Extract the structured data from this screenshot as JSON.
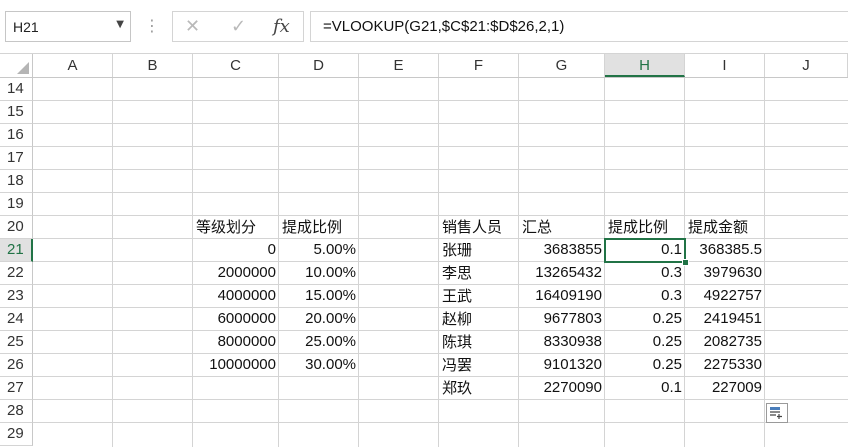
{
  "name_box": {
    "value": "H21"
  },
  "formula_bar": {
    "cancel_icon": "✕",
    "enter_icon": "✓",
    "fx_label": "fx",
    "formula": "=VLOOKUP(G21,$C$21:$D$26,2,1)"
  },
  "columns": [
    "A",
    "B",
    "C",
    "D",
    "E",
    "F",
    "G",
    "H",
    "I",
    "J"
  ],
  "selected_column": "H",
  "rows": [
    "14",
    "15",
    "16",
    "17",
    "18",
    "19",
    "20",
    "21",
    "22",
    "23",
    "24",
    "25",
    "26",
    "27",
    "28",
    "29"
  ],
  "selected_row": "21",
  "tier_table": {
    "headers": {
      "threshold": "等级划分",
      "rate": "提成比例"
    },
    "rows": [
      {
        "threshold": "0",
        "rate": "5.00%"
      },
      {
        "threshold": "2000000",
        "rate": "10.00%"
      },
      {
        "threshold": "4000000",
        "rate": "15.00%"
      },
      {
        "threshold": "6000000",
        "rate": "20.00%"
      },
      {
        "threshold": "8000000",
        "rate": "25.00%"
      },
      {
        "threshold": "10000000",
        "rate": "30.00%"
      }
    ]
  },
  "sales_table": {
    "headers": {
      "person": "销售人员",
      "total": "汇总",
      "rate": "提成比例",
      "amount": "提成金额"
    },
    "rows": [
      {
        "person": "张珊",
        "total": "3683855",
        "rate": "0.1",
        "amount": "368385.5"
      },
      {
        "person": "李思",
        "total": "13265432",
        "rate": "0.3",
        "amount": "3979630"
      },
      {
        "person": "王武",
        "total": "16409190",
        "rate": "0.3",
        "amount": "4922757"
      },
      {
        "person": "赵柳",
        "total": "9677803",
        "rate": "0.25",
        "amount": "2419451"
      },
      {
        "person": "陈琪",
        "total": "8330938",
        "rate": "0.25",
        "amount": "2082735"
      },
      {
        "person": "冯罢",
        "total": "9101320",
        "rate": "0.25",
        "amount": "2275330"
      },
      {
        "person": "郑玖",
        "total": "2270090",
        "rate": "0.1",
        "amount": "227009"
      }
    ]
  },
  "icons": {
    "quick_analysis": "quick-analysis-icon",
    "select_all": "select-all-triangle-icon"
  },
  "colors": {
    "accent": "#217346",
    "grid": "#d4d4d4",
    "header_selected": "#e1e1e1"
  }
}
